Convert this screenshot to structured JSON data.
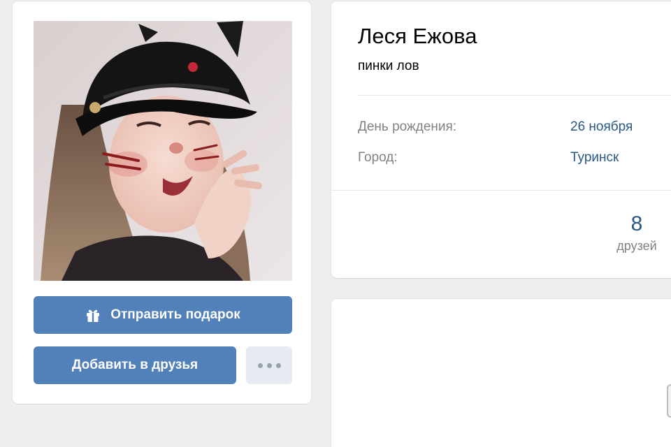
{
  "profile": {
    "name": "Леся Ежова",
    "status": "пинки лов"
  },
  "info": [
    {
      "label": "День рождения:",
      "value": "26 ноября"
    },
    {
      "label": "Город:",
      "value": "Туринск"
    }
  ],
  "counters": {
    "friends_count": "8",
    "friends_label": "друзей"
  },
  "actions": {
    "gift_label": "Отправить подарок",
    "add_friend_label": "Добавить в друзья",
    "more_icon": "more-dots-icon",
    "gift_icon": "gift-icon"
  },
  "colors": {
    "accent": "#5181b8",
    "link": "#2a5885",
    "background": "#edeef0",
    "secondary_button": "#e5ebf1"
  }
}
